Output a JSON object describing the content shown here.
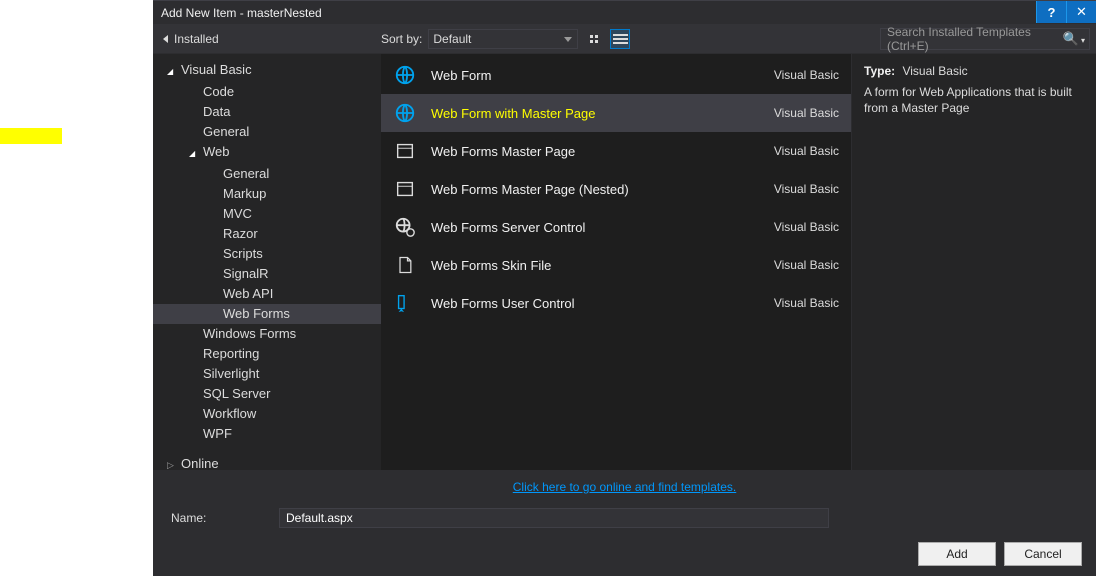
{
  "titlebar": {
    "title": "Add New Item - masterNested",
    "help": "?",
    "close": "✕"
  },
  "tabs": {
    "installed": "Installed"
  },
  "sort": {
    "label": "Sort by:",
    "value": "Default"
  },
  "search": {
    "placeholder": "Search Installed Templates (Ctrl+E)"
  },
  "tree": {
    "root": "Visual Basic",
    "items1": [
      "Code",
      "Data",
      "General"
    ],
    "web": "Web",
    "webItems": [
      "General",
      "Markup",
      "MVC",
      "Razor",
      "Scripts",
      "SignalR",
      "Web API",
      "Web Forms"
    ],
    "items2": [
      "Windows Forms",
      "Reporting",
      "Silverlight",
      "SQL Server",
      "Workflow",
      "WPF"
    ],
    "online": "Online"
  },
  "templates": [
    {
      "label": "Web Form",
      "lang": "Visual Basic",
      "icon": "globe"
    },
    {
      "label": "Web Form with Master Page",
      "lang": "Visual Basic",
      "icon": "globe",
      "selected": true
    },
    {
      "label": "Web Forms Master Page",
      "lang": "Visual Basic",
      "icon": "page"
    },
    {
      "label": "Web Forms Master Page (Nested)",
      "lang": "Visual Basic",
      "icon": "page"
    },
    {
      "label": "Web Forms Server Control",
      "lang": "Visual Basic",
      "icon": "globe-gear"
    },
    {
      "label": "Web Forms Skin File",
      "lang": "Visual Basic",
      "icon": "file"
    },
    {
      "label": "Web Forms User Control",
      "lang": "Visual Basic",
      "icon": "pencil"
    }
  ],
  "detail": {
    "typeLabel": "Type:",
    "typeValue": "Visual Basic",
    "description": "A form for Web Applications that is built from a Master Page"
  },
  "onlineLink": "Click here to go online and find templates.",
  "nameRow": {
    "label": "Name:",
    "value": "Default.aspx"
  },
  "buttons": {
    "add": "Add",
    "cancel": "Cancel"
  }
}
